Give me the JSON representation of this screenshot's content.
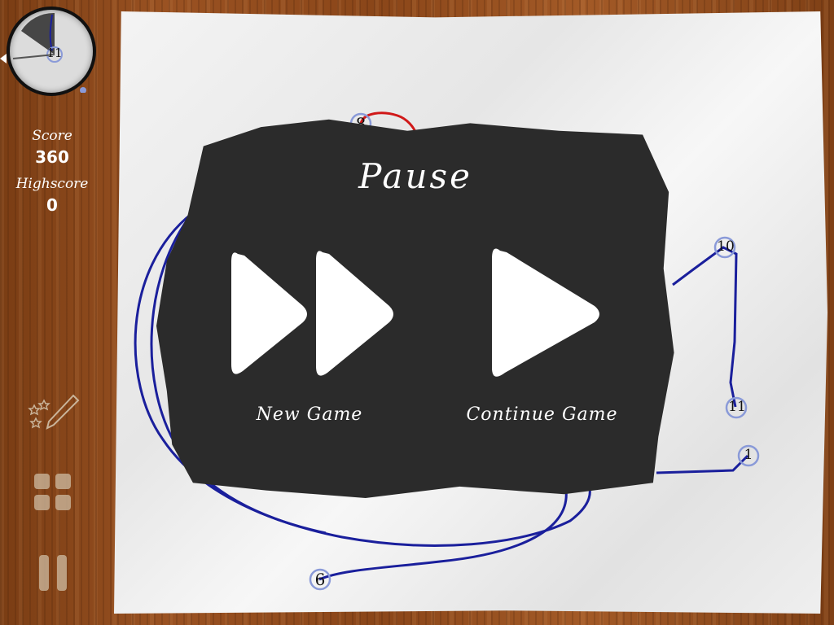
{
  "hud": {
    "clock_number": "11",
    "score_label": "Score",
    "score_value": "360",
    "highscore_label": "Highscore",
    "highscore_value": "0"
  },
  "board": {
    "node_labels": [
      "8",
      "10",
      "11",
      "1",
      "6"
    ]
  },
  "pause_menu": {
    "title": "Pause",
    "new_game_label": "New Game",
    "continue_label": "Continue Game"
  },
  "colors": {
    "path_blue": "#1a1f9c",
    "path_red": "#d01818",
    "panel": "#2b2b2b",
    "node_ring": "#8a9ad8"
  },
  "icons": {
    "new_game": "fast-forward-icon",
    "continue": "play-icon",
    "edit": "stars-pencil-icon",
    "menu": "grid-icon",
    "pause": "pause-icon"
  }
}
